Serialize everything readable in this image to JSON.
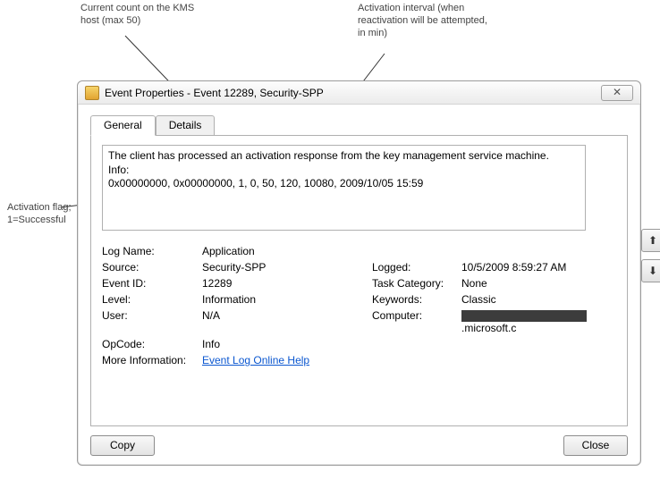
{
  "callouts": {
    "count": "Current count on the KMS host (max 50)",
    "interval": "Activation interval (when reactivation will be attempted, in min)",
    "flag": "Activation flag; 1=Successful"
  },
  "window": {
    "title": "Event Properties - Event 12289, Security-SPP",
    "close_glyph": "✕"
  },
  "tabs": {
    "general": "General",
    "details": "Details"
  },
  "description": {
    "line1": "The client has processed an activation response from the key management service machine.",
    "line2": "Info:",
    "line3": "0x00000000, 0x00000000, 1, 0, 50, 120, 10080, 2009/10/05 15:59"
  },
  "fields": {
    "log_name": {
      "label": "Log Name:",
      "value": "Application"
    },
    "source": {
      "label": "Source:",
      "value": "Security-SPP"
    },
    "logged": {
      "label": "Logged:",
      "value": "10/5/2009 8:59:27 AM"
    },
    "event_id": {
      "label": "Event ID:",
      "value": "12289"
    },
    "task_cat": {
      "label": "Task Category:",
      "value": "None"
    },
    "level": {
      "label": "Level:",
      "value": "Information"
    },
    "keywords": {
      "label": "Keywords:",
      "value": "Classic"
    },
    "user": {
      "label": "User:",
      "value": "N/A"
    },
    "computer": {
      "label": "Computer:",
      "suffix": ".microsoft.c"
    },
    "opcode": {
      "label": "OpCode:",
      "value": "Info"
    },
    "more_info": {
      "label": "More Information:",
      "link": "Event Log Online Help"
    }
  },
  "nav": {
    "up": "⬆",
    "down": "⬇"
  },
  "buttons": {
    "copy": "Copy",
    "close": "Close"
  }
}
